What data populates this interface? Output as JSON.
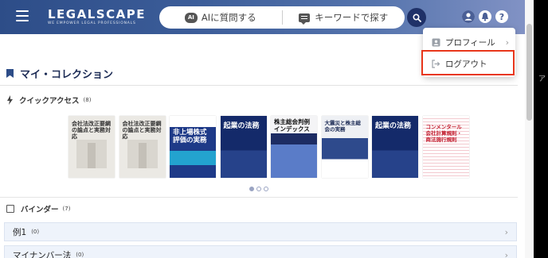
{
  "header": {
    "logo_word": "LEGALSCAPE",
    "logo_tagline": "WE EMPOWER LEGAL PROFESSIONALS",
    "ai_badge": "AI",
    "ai_question_label": "AIに質問する",
    "keyword_search_label": "キーワードで探す",
    "icons": [
      "menu-icon",
      "chat-icon",
      "search-icon",
      "account-icon",
      "notification-icon",
      "help-icon"
    ],
    "help_glyph": "?"
  },
  "main": {
    "title": "マイ・コレクション",
    "quick_access": {
      "label": "クイックアクセス",
      "count": "(8)"
    },
    "binder": {
      "label": "バインダー",
      "count": "(7)"
    },
    "rows": [
      {
        "label": "例1",
        "count": "(0)"
      },
      {
        "label": "マイナンバー法",
        "count": "(0)"
      }
    ]
  },
  "books": [
    {
      "title": "会社法改正要綱の論点と実務対応",
      "style": "grey"
    },
    {
      "title": "会社法改正要綱の論点と実務対応",
      "style": "grey"
    },
    {
      "title": "非上場株式評価の実務",
      "style": "blue"
    },
    {
      "title": "起業の法務",
      "style": "navy"
    },
    {
      "title": "株主総会判例インデックス",
      "style": "white"
    },
    {
      "title": "大震災と株主総会の実務",
      "style": "white"
    },
    {
      "title": "起業の法務",
      "style": "navy"
    },
    {
      "title": "コンメンタール会社計算規則・商法施行規則",
      "style": "stripe"
    }
  ],
  "carousel": {
    "pages": 3,
    "active": 0
  },
  "menu": {
    "items": [
      {
        "label": "プロフィール",
        "icon": "profile-icon"
      },
      {
        "label": "ログアウト",
        "icon": "logout-icon",
        "highlighted": true
      }
    ]
  },
  "colors": {
    "header_start": "#2d4d88",
    "header_end": "#8494c6",
    "accent": "#1f3168",
    "highlight": "#e8361b"
  }
}
